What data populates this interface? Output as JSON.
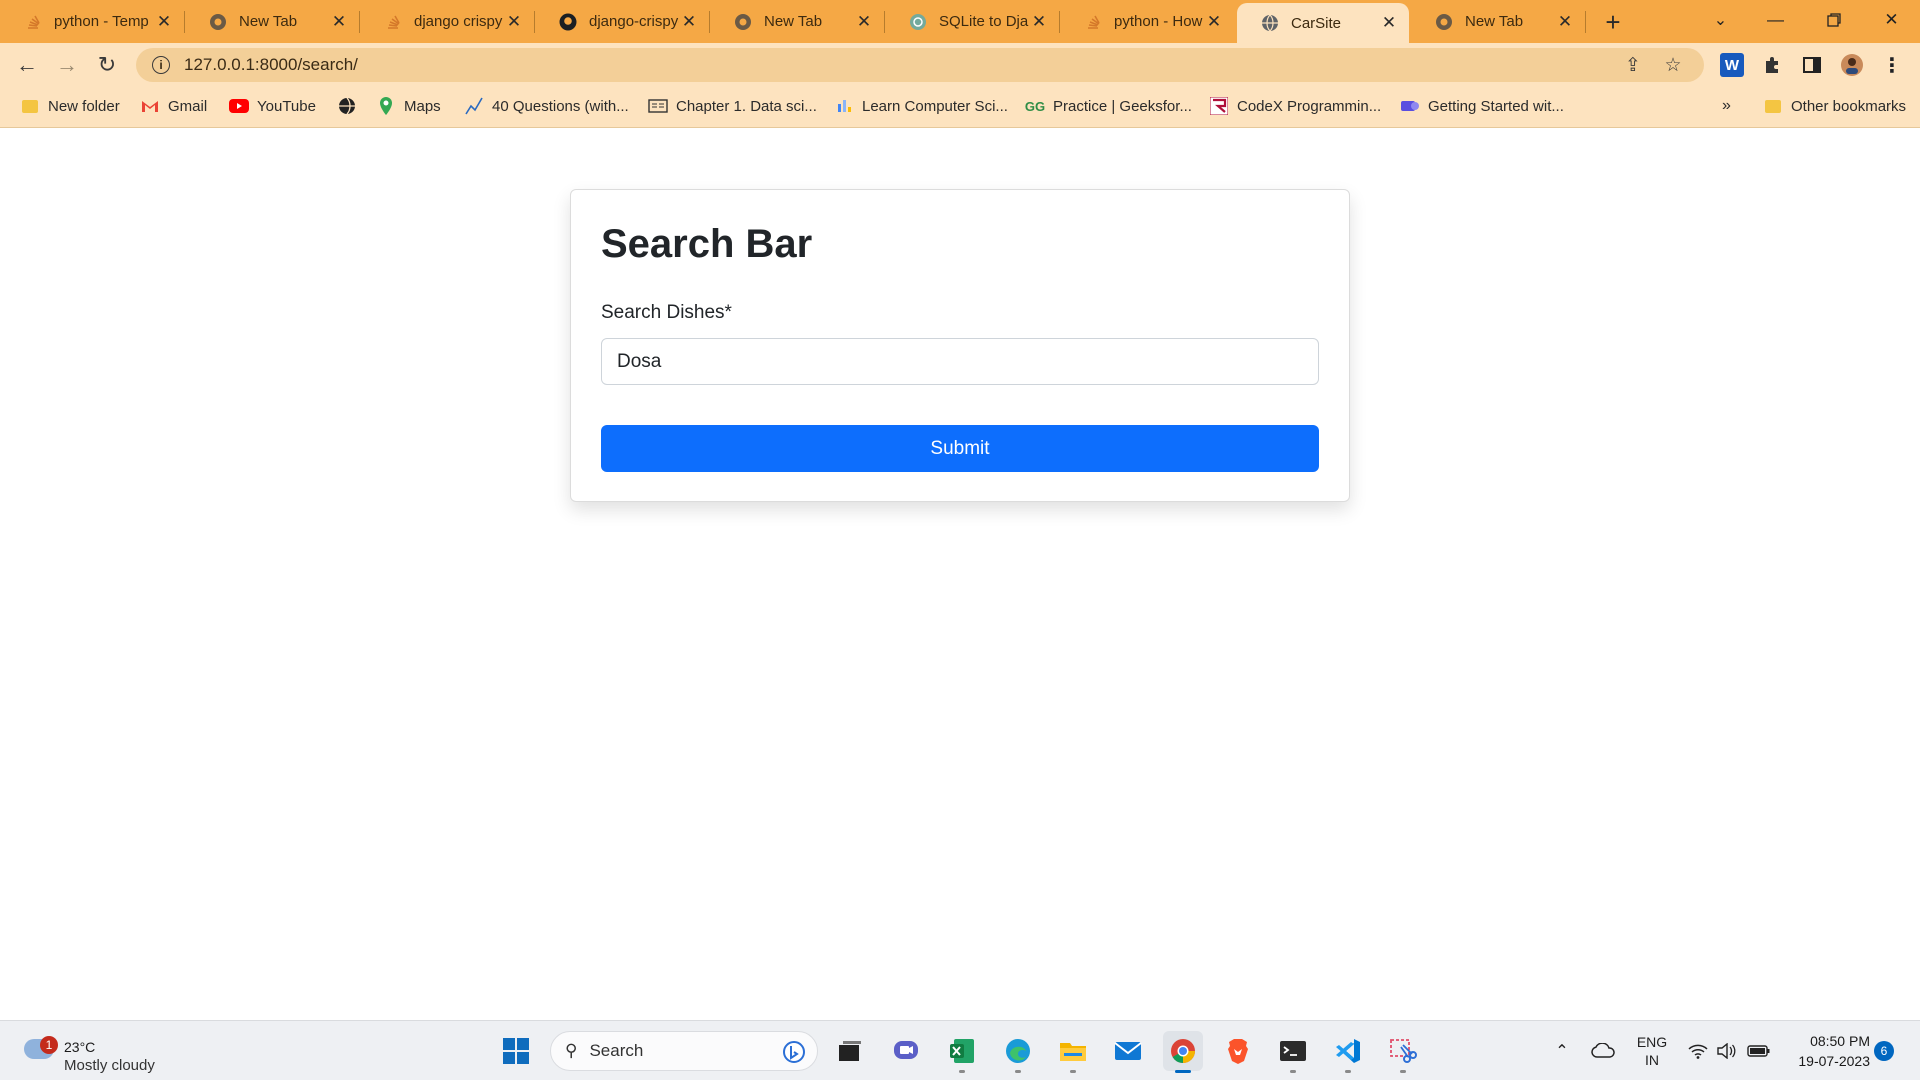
{
  "browser": {
    "tabs": [
      {
        "title": "python - Temp",
        "favicon": "stackoverflow-icon",
        "active": false
      },
      {
        "title": "New Tab",
        "favicon": "chrome-icon",
        "active": false
      },
      {
        "title": "django crispy",
        "favicon": "stackoverflow-icon",
        "active": false
      },
      {
        "title": "django-crispy-",
        "favicon": "github-icon",
        "active": false
      },
      {
        "title": "New Tab",
        "favicon": "chrome-icon",
        "active": false
      },
      {
        "title": "SQLite to Djan",
        "favicon": "chatgpt-icon",
        "active": false
      },
      {
        "title": "python - How",
        "favicon": "stackoverflow-icon",
        "active": false
      },
      {
        "title": "CarSite",
        "favicon": "globe-icon",
        "active": true
      },
      {
        "title": "New Tab",
        "favicon": "chrome-icon",
        "active": false
      }
    ],
    "url": "127.0.0.1:8000/search/",
    "bookmarks": [
      {
        "label": "New folder",
        "icon": "folder-icon"
      },
      {
        "label": "Gmail",
        "icon": "gmail-icon"
      },
      {
        "label": "YouTube",
        "icon": "youtube-icon"
      },
      {
        "label": "",
        "icon": "globe-icon"
      },
      {
        "label": "Maps",
        "icon": "maps-icon"
      },
      {
        "label": "40 Questions (with...",
        "icon": "chart-icon"
      },
      {
        "label": "Chapter 1. Data sci...",
        "icon": "book-icon"
      },
      {
        "label": "Learn Computer Sci...",
        "icon": "bars-icon"
      },
      {
        "label": "Practice | Geeksfor...",
        "icon": "geeksforgeeks-icon"
      },
      {
        "label": "CodeX Programmin...",
        "icon": "codex-icon"
      },
      {
        "label": "Getting Started wit...",
        "icon": "tag-icon"
      }
    ],
    "other_bookmarks": "Other bookmarks",
    "colors": {
      "frame": "#f5a845",
      "toolbar": "#fde3bf",
      "omnibox": "#f3cf98"
    }
  },
  "page": {
    "heading": "Search Bar",
    "label": "Search Dishes*",
    "input_value": "Dosa",
    "submit_label": "Submit",
    "colors": {
      "button": "#0d6efd"
    }
  },
  "taskbar": {
    "weather": {
      "badge": "1",
      "temp": "23°C",
      "condition": "Mostly cloudy"
    },
    "search_placeholder": "Search",
    "language": {
      "line1": "ENG",
      "line2": "IN"
    },
    "time": "08:50 PM",
    "date": "19-07-2023",
    "notifications": "6"
  }
}
